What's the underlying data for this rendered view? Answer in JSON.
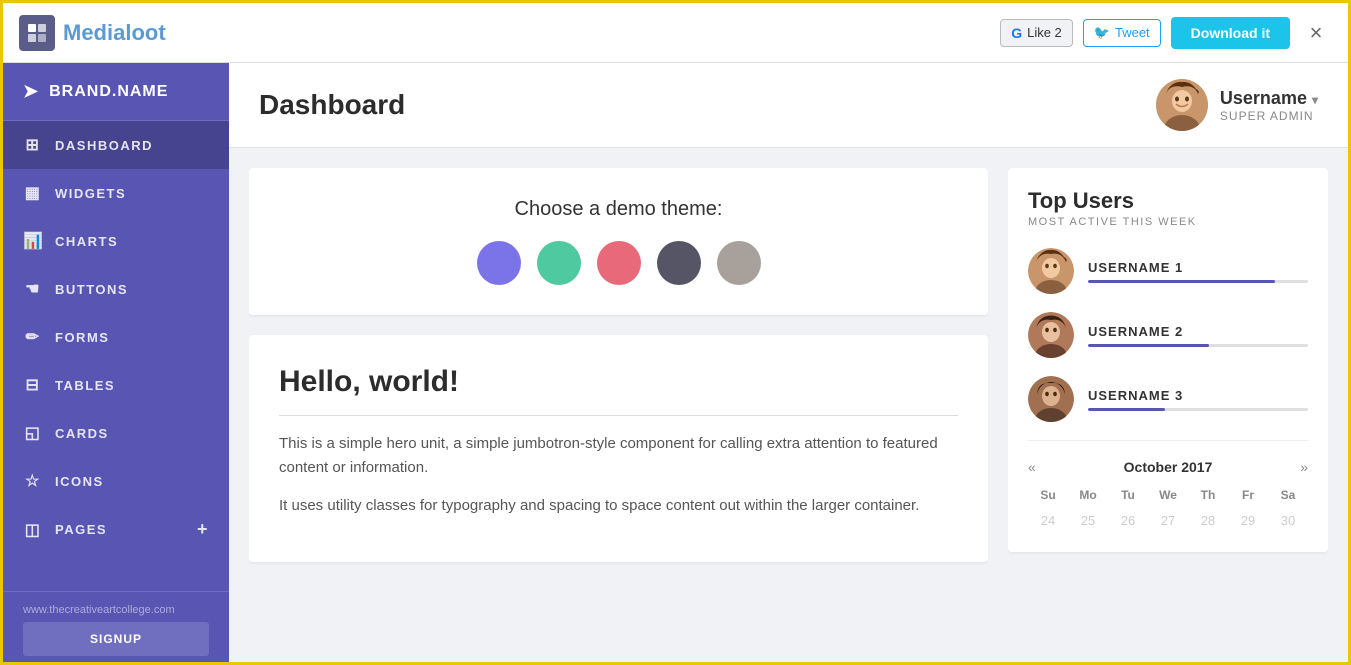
{
  "topbar": {
    "logo_text_black": "Media",
    "logo_text_blue": "loot",
    "fb_like": "Like 2",
    "tweet": "Tweet",
    "download": "Download it",
    "close": "×"
  },
  "sidebar": {
    "brand": "BRAND.NAME",
    "items": [
      {
        "id": "dashboard",
        "label": "DASHBOARD",
        "icon": "⊞"
      },
      {
        "id": "widgets",
        "label": "WIDGETS",
        "icon": "🗓"
      },
      {
        "id": "charts",
        "label": "CHARTS",
        "icon": "📊"
      },
      {
        "id": "buttons",
        "label": "BUTTONS",
        "icon": "🤚"
      },
      {
        "id": "forms",
        "label": "FORMS",
        "icon": "✏"
      },
      {
        "id": "tables",
        "label": "TABLES",
        "icon": "⊞"
      },
      {
        "id": "cards",
        "label": "CARDS",
        "icon": "🗒"
      },
      {
        "id": "icons",
        "label": "ICONS",
        "icon": "☆"
      },
      {
        "id": "pages",
        "label": "PAGES",
        "icon": "🗋"
      }
    ],
    "bottom_text": "www.thecreativeartcollege.com",
    "signup": "SIGNUP"
  },
  "header": {
    "page_title": "Dashboard",
    "user_name": "Username",
    "user_role": "SUPER ADMIN",
    "dropdown_arrow": "▾"
  },
  "theme_chooser": {
    "title": "Choose a demo theme:",
    "colors": [
      "#7b74e8",
      "#4ec9a0",
      "#e8697a",
      "#555566",
      "#a8a09a"
    ]
  },
  "hero": {
    "title": "Hello, world!",
    "text1": "This is a simple hero unit, a simple jumbotron-style component for calling extra attention to featured content or information.",
    "text2": "It uses utility classes for typography and spacing to space content out within the larger container."
  },
  "top_users": {
    "title": "Top Users",
    "subtitle": "MOST ACTIVE THIS WEEK",
    "users": [
      {
        "name": "USERNAME 1",
        "progress": 85
      },
      {
        "name": "USERNAME 2",
        "progress": 55
      },
      {
        "name": "USERNAME 3",
        "progress": 35
      }
    ]
  },
  "calendar": {
    "prev": "«",
    "next": "»",
    "month": "October 2017",
    "day_headers": [
      "Su",
      "Mo",
      "Tu",
      "We",
      "Th",
      "Fr",
      "Sa"
    ],
    "days": [
      {
        "num": "24",
        "other": true
      },
      {
        "num": "25",
        "other": true
      },
      {
        "num": "26",
        "other": true
      },
      {
        "num": "27",
        "other": true
      },
      {
        "num": "28",
        "other": true
      },
      {
        "num": "29",
        "other": true
      },
      {
        "num": "30",
        "other": true
      }
    ]
  }
}
